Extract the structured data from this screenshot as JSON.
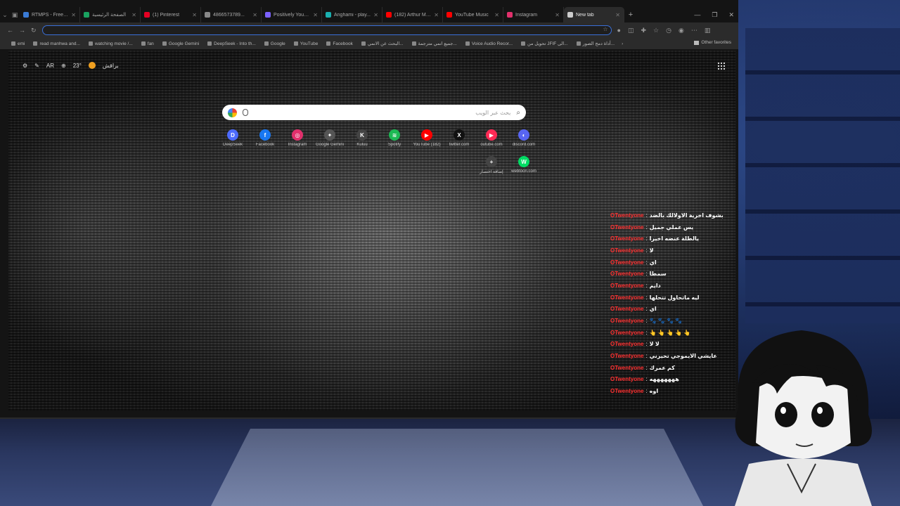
{
  "tabs": [
    {
      "label": "RTMPS - Free Vid...",
      "color": "#3a7bd5",
      "active": false
    },
    {
      "label": "الصفحة الرئيسية",
      "color": "#1aa260",
      "active": false
    },
    {
      "label": "(1) Pinterest",
      "color": "#e60023",
      "active": false
    },
    {
      "label": "4866573789...",
      "color": "#888888",
      "active": false
    },
    {
      "label": "Positively Yours - مانها",
      "color": "#7b61ff",
      "active": false
    },
    {
      "label": "Anghami - play...",
      "color": "#1ab0b0",
      "active": false
    },
    {
      "label": "(182) Arthur Morgan...",
      "color": "#ff0000",
      "active": false
    },
    {
      "label": "YouTube Music",
      "color": "#ff0000",
      "active": false
    },
    {
      "label": "Instagram",
      "color": "#e1306c",
      "active": false
    },
    {
      "label": "New tab",
      "color": "#cccccc",
      "active": true
    }
  ],
  "bookmarks": [
    {
      "label": "emi"
    },
    {
      "label": "read manhwa and..."
    },
    {
      "label": "watching movie /..."
    },
    {
      "label": "fan"
    },
    {
      "label": "Google Gemini"
    },
    {
      "label": "DeepSeek - Into th..."
    },
    {
      "label": "Google"
    },
    {
      "label": "YouTube"
    },
    {
      "label": "Facebook"
    },
    {
      "label": "البحث عن الانمي..."
    },
    {
      "label": "جميع انمي مترجمة..."
    },
    {
      "label": "Voice Audio Recor..."
    },
    {
      "label": "تحويل من JFIF الى..."
    },
    {
      "label": "أداة دمج الصور..."
    }
  ],
  "bookmarks_other": "Other favorites",
  "ntp": {
    "lang": "AR",
    "temperature": "23°",
    "weather_label": "براقش",
    "search_placeholder": "بحث عبر الويب"
  },
  "shortcuts": [
    {
      "label": "DeepSeek",
      "glyph": "D",
      "color": "#4d6bfe"
    },
    {
      "label": "Facebook",
      "glyph": "f",
      "color": "#1877f2"
    },
    {
      "label": "Instagram",
      "glyph": "◎",
      "color": "#e1306c"
    },
    {
      "label": "Google Gemini",
      "glyph": "✦",
      "color": "#555555"
    },
    {
      "label": "Kuluu",
      "glyph": "K",
      "color": "#444444"
    },
    {
      "label": "Spotify",
      "glyph": "≋",
      "color": "#1db954"
    },
    {
      "label": "YouTube (182)",
      "glyph": "▶",
      "color": "#ff0000"
    },
    {
      "label": "twitter.com",
      "glyph": "X",
      "color": "#111111"
    },
    {
      "label": "outube.com",
      "glyph": "▶",
      "color": "#ff2a55"
    },
    {
      "label": "discord.com",
      "glyph": "◐",
      "color": "#5865f2"
    },
    {
      "label": "إضافة اختصار",
      "glyph": "+",
      "color": "#444444"
    },
    {
      "label": "webtoon.com",
      "glyph": "W",
      "color": "#00dc64"
    }
  ],
  "chat": {
    "username": "OTwentyone",
    "messages": [
      "بشوف اخرية الاولالك بالضد",
      "يس عملي جميل",
      "يالطلة عنضه اخيرا",
      "لا",
      "اي",
      "سمطا",
      "دايم",
      "ليه ماتحاول تتحلها",
      "اي",
      "🐾 🐾 🐾 🐾",
      "👆 👆 👆 👆 👆",
      "لا لا",
      "عايشي الايموجي تحيرني",
      "كم عمرك",
      "هههههههه",
      "اوه"
    ]
  }
}
